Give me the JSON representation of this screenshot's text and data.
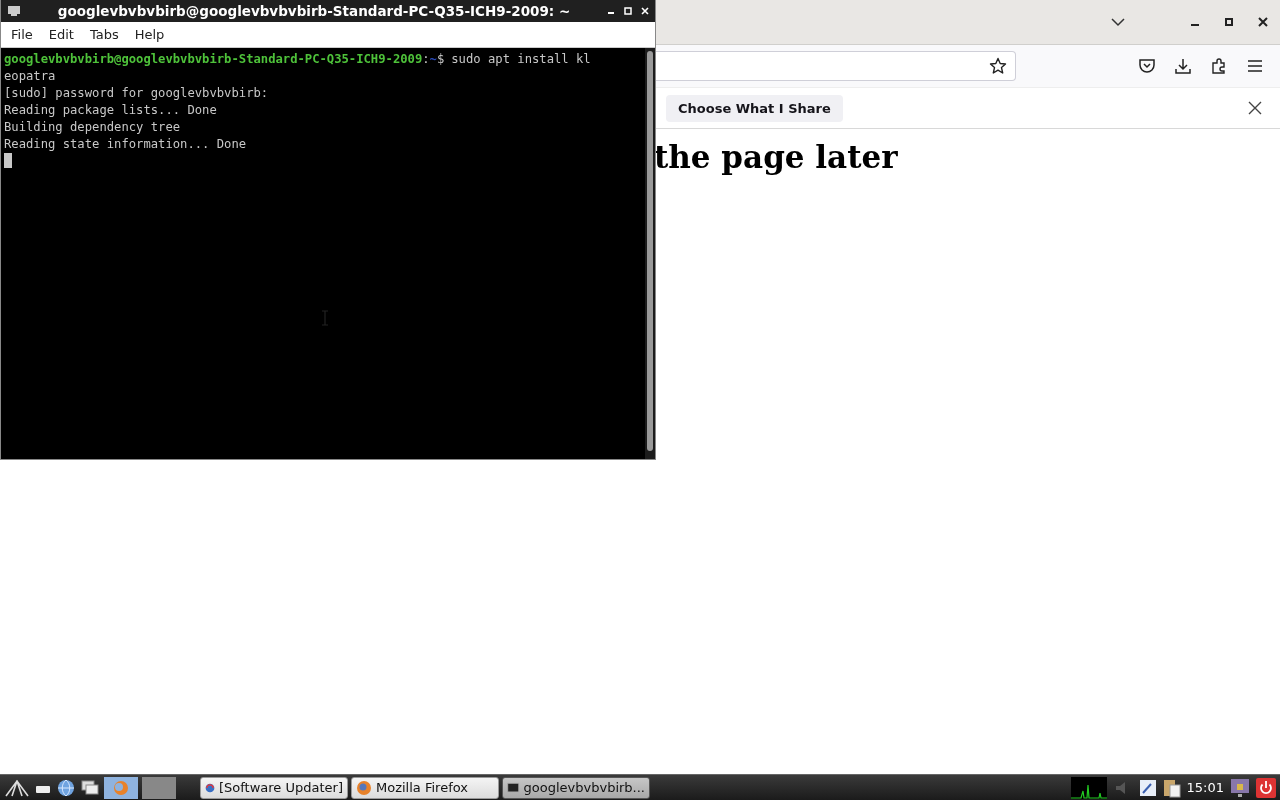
{
  "terminal": {
    "title": "googlevbvbvbirb@googlevbvbvbirb-Standard-PC-Q35-ICH9-2009: ~",
    "menu": [
      "File",
      "Edit",
      "Tabs",
      "Help"
    ],
    "prompt": {
      "user_host": "googlevbvbvbirb@googlevbvbvbirb-Standard-PC-Q35-ICH9-2009",
      "separator": ":",
      "path": "~",
      "symbol": "$",
      "command": "sudo apt install kl"
    },
    "output": [
      "eopatra",
      "[sudo] password for googlevbvbvbirb:",
      "Reading package lists... Done",
      "Building dependency tree",
      "Reading state information... Done"
    ]
  },
  "firefox": {
    "notification": {
      "button": "Choose What I Share"
    },
    "heading": "the page later"
  },
  "taskbar": {
    "tasks": [
      {
        "label": "[Software Updater]",
        "kind": "updater",
        "selected": false
      },
      {
        "label": "Mozilla Firefox",
        "kind": "firefox",
        "selected": false
      },
      {
        "label": "googlevbvbvbirb...",
        "kind": "terminal",
        "selected": true
      }
    ],
    "clock": "15:01"
  }
}
